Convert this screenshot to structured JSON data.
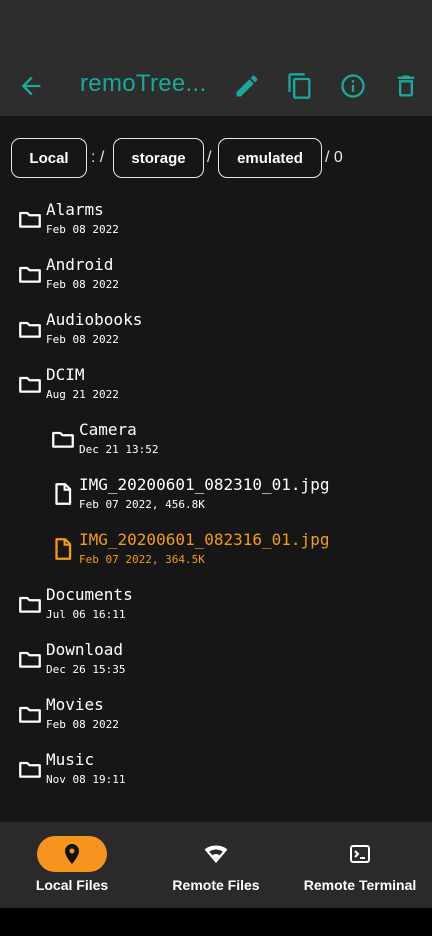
{
  "app": {
    "title": "remoTree..."
  },
  "colors": {
    "accent": "#1aa79c",
    "selected": "#f39c12",
    "active_pill": "#f7941d"
  },
  "breadcrumb": {
    "root": "Local",
    "sep1": ": /",
    "seg1": "storage",
    "sep2": "/",
    "seg2": "emulated",
    "tail": "/ 0"
  },
  "files": [
    {
      "name": "Alarms",
      "date": "Feb 08  2022",
      "type": "folder"
    },
    {
      "name": "Android",
      "date": "Feb 08  2022",
      "type": "folder"
    },
    {
      "name": "Audiobooks",
      "date": "Feb 08  2022",
      "type": "folder"
    },
    {
      "name": "DCIM",
      "date": "Aug 21  2022",
      "type": "folder"
    },
    {
      "name": "Camera",
      "date": "Dec 21 13:52",
      "type": "folder"
    },
    {
      "name": "IMG_20200601_082310_01.jpg",
      "date": "Feb 07  2022, 456.8K",
      "type": "file"
    },
    {
      "name": "IMG_20200601_082316_01.jpg",
      "date": "Feb 07  2022, 364.5K",
      "type": "file",
      "selected": true
    },
    {
      "name": "Documents",
      "date": "Jul 06 16:11",
      "type": "folder"
    },
    {
      "name": "Download",
      "date": "Dec 26 15:35",
      "type": "folder"
    },
    {
      "name": "Movies",
      "date": "Feb 08  2022",
      "type": "folder"
    },
    {
      "name": "Music",
      "date": "Nov 08 19:11",
      "type": "folder"
    }
  ],
  "bottom_nav": [
    {
      "label": "Local Files",
      "icon": "location-pin-icon",
      "active": true
    },
    {
      "label": "Remote Files",
      "icon": "wifi-icon",
      "active": false
    },
    {
      "label": "Remote Terminal",
      "icon": "terminal-icon",
      "active": false
    }
  ]
}
